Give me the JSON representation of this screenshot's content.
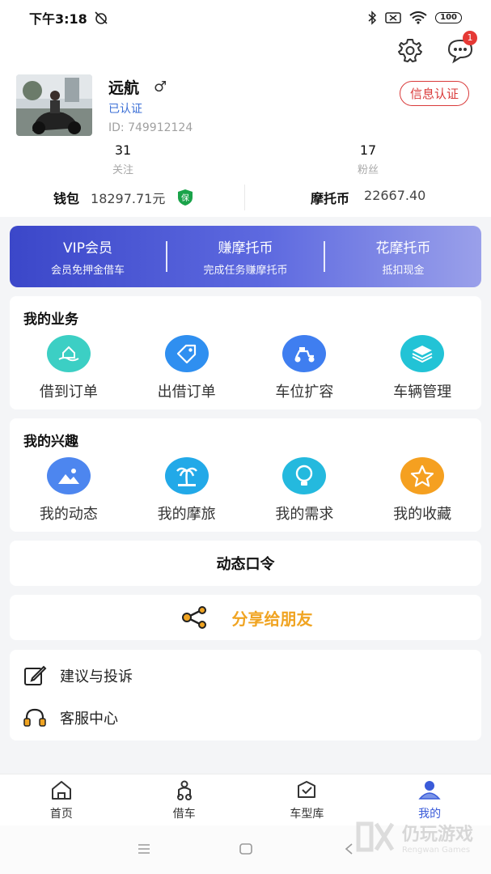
{
  "status_bar": {
    "time": "下午3:18",
    "battery": "100"
  },
  "header": {
    "message_badge": "1",
    "user": {
      "name": "远航",
      "gender_symbol": "♂",
      "verified": "已认证",
      "id": "ID: 749912124"
    },
    "auth_button": "信息认证",
    "stats": [
      {
        "value": "31",
        "label": "关注"
      },
      {
        "value": "17",
        "label": "粉丝"
      }
    ],
    "wallet": {
      "label": "钱包",
      "value": "18297.71元",
      "badge": "保"
    },
    "coins": {
      "label": "摩托币",
      "value": "22667.40"
    }
  },
  "vip_banner": [
    {
      "title": "VIP会员",
      "subtitle": "会员免押金借车"
    },
    {
      "title": "赚摩托币",
      "subtitle": "完成任务赚摩托币"
    },
    {
      "title": "花摩托币",
      "subtitle": "抵扣现金"
    }
  ],
  "business": {
    "title": "我的业务",
    "items": [
      {
        "label": "借到订单",
        "icon": "house-hand-icon",
        "color": "#3ccfc4"
      },
      {
        "label": "出借订单",
        "icon": "tag-icon",
        "color": "#2f8ff0"
      },
      {
        "label": "车位扩容",
        "icon": "scooter-icon",
        "color": "#3f7ef0"
      },
      {
        "label": "车辆管理",
        "icon": "layers-icon",
        "color": "#22c3d6"
      }
    ]
  },
  "interests": {
    "title": "我的兴趣",
    "items": [
      {
        "label": "我的动态",
        "icon": "image-icon",
        "color": "#4d86ef"
      },
      {
        "label": "我的摩旅",
        "icon": "palm-tree-icon",
        "color": "#22a9e8"
      },
      {
        "label": "我的需求",
        "icon": "lightbulb-icon",
        "color": "#24b9de"
      },
      {
        "label": "我的收藏",
        "icon": "star-icon",
        "color": "#f5a020"
      }
    ]
  },
  "dynamic_password": "动态口令",
  "share": "分享给朋友",
  "list": [
    {
      "label": "建议与投诉",
      "icon": "edit-icon"
    },
    {
      "label": "客服中心",
      "icon": "headset-icon"
    }
  ],
  "tabs": [
    {
      "label": "首页",
      "icon": "home-icon"
    },
    {
      "label": "借车",
      "icon": "scooter-tab-icon"
    },
    {
      "label": "车型库",
      "icon": "box-check-icon"
    },
    {
      "label": "我的",
      "icon": "user-icon",
      "active": true
    }
  ],
  "watermark": {
    "title": "仍玩游戏",
    "subtitle": "Rengwan Games"
  },
  "colors": {
    "accent": "#3a5bd9",
    "auth": "#d93a3a",
    "share": "#f0a422"
  }
}
